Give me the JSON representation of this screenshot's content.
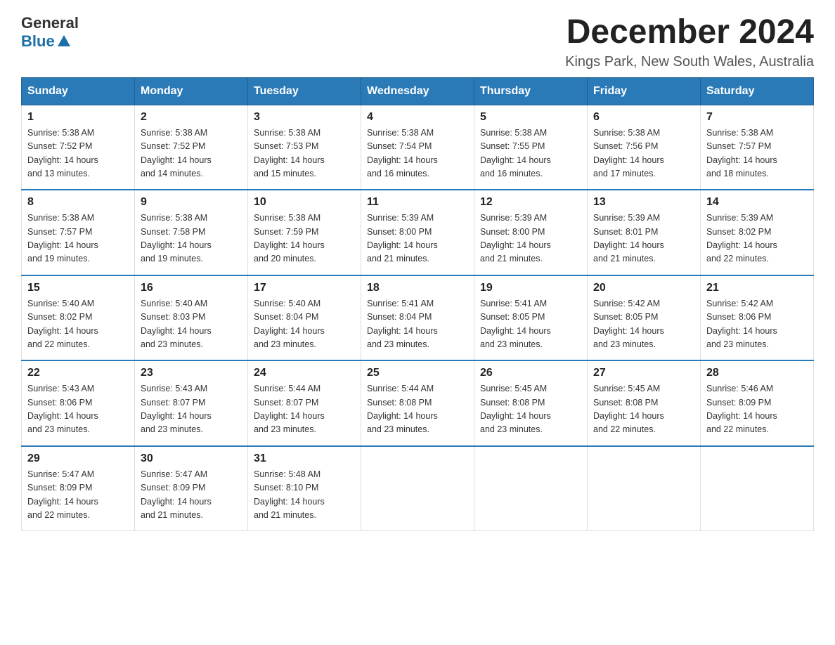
{
  "header": {
    "logo_general": "General",
    "logo_blue": "Blue",
    "month_year": "December 2024",
    "location": "Kings Park, New South Wales, Australia"
  },
  "columns": [
    "Sunday",
    "Monday",
    "Tuesday",
    "Wednesday",
    "Thursday",
    "Friday",
    "Saturday"
  ],
  "weeks": [
    [
      {
        "day": "1",
        "sunrise": "5:38 AM",
        "sunset": "7:52 PM",
        "daylight": "14 hours and 13 minutes."
      },
      {
        "day": "2",
        "sunrise": "5:38 AM",
        "sunset": "7:52 PM",
        "daylight": "14 hours and 14 minutes."
      },
      {
        "day": "3",
        "sunrise": "5:38 AM",
        "sunset": "7:53 PM",
        "daylight": "14 hours and 15 minutes."
      },
      {
        "day": "4",
        "sunrise": "5:38 AM",
        "sunset": "7:54 PM",
        "daylight": "14 hours and 16 minutes."
      },
      {
        "day": "5",
        "sunrise": "5:38 AM",
        "sunset": "7:55 PM",
        "daylight": "14 hours and 16 minutes."
      },
      {
        "day": "6",
        "sunrise": "5:38 AM",
        "sunset": "7:56 PM",
        "daylight": "14 hours and 17 minutes."
      },
      {
        "day": "7",
        "sunrise": "5:38 AM",
        "sunset": "7:57 PM",
        "daylight": "14 hours and 18 minutes."
      }
    ],
    [
      {
        "day": "8",
        "sunrise": "5:38 AM",
        "sunset": "7:57 PM",
        "daylight": "14 hours and 19 minutes."
      },
      {
        "day": "9",
        "sunrise": "5:38 AM",
        "sunset": "7:58 PM",
        "daylight": "14 hours and 19 minutes."
      },
      {
        "day": "10",
        "sunrise": "5:38 AM",
        "sunset": "7:59 PM",
        "daylight": "14 hours and 20 minutes."
      },
      {
        "day": "11",
        "sunrise": "5:39 AM",
        "sunset": "8:00 PM",
        "daylight": "14 hours and 21 minutes."
      },
      {
        "day": "12",
        "sunrise": "5:39 AM",
        "sunset": "8:00 PM",
        "daylight": "14 hours and 21 minutes."
      },
      {
        "day": "13",
        "sunrise": "5:39 AM",
        "sunset": "8:01 PM",
        "daylight": "14 hours and 21 minutes."
      },
      {
        "day": "14",
        "sunrise": "5:39 AM",
        "sunset": "8:02 PM",
        "daylight": "14 hours and 22 minutes."
      }
    ],
    [
      {
        "day": "15",
        "sunrise": "5:40 AM",
        "sunset": "8:02 PM",
        "daylight": "14 hours and 22 minutes."
      },
      {
        "day": "16",
        "sunrise": "5:40 AM",
        "sunset": "8:03 PM",
        "daylight": "14 hours and 23 minutes."
      },
      {
        "day": "17",
        "sunrise": "5:40 AM",
        "sunset": "8:04 PM",
        "daylight": "14 hours and 23 minutes."
      },
      {
        "day": "18",
        "sunrise": "5:41 AM",
        "sunset": "8:04 PM",
        "daylight": "14 hours and 23 minutes."
      },
      {
        "day": "19",
        "sunrise": "5:41 AM",
        "sunset": "8:05 PM",
        "daylight": "14 hours and 23 minutes."
      },
      {
        "day": "20",
        "sunrise": "5:42 AM",
        "sunset": "8:05 PM",
        "daylight": "14 hours and 23 minutes."
      },
      {
        "day": "21",
        "sunrise": "5:42 AM",
        "sunset": "8:06 PM",
        "daylight": "14 hours and 23 minutes."
      }
    ],
    [
      {
        "day": "22",
        "sunrise": "5:43 AM",
        "sunset": "8:06 PM",
        "daylight": "14 hours and 23 minutes."
      },
      {
        "day": "23",
        "sunrise": "5:43 AM",
        "sunset": "8:07 PM",
        "daylight": "14 hours and 23 minutes."
      },
      {
        "day": "24",
        "sunrise": "5:44 AM",
        "sunset": "8:07 PM",
        "daylight": "14 hours and 23 minutes."
      },
      {
        "day": "25",
        "sunrise": "5:44 AM",
        "sunset": "8:08 PM",
        "daylight": "14 hours and 23 minutes."
      },
      {
        "day": "26",
        "sunrise": "5:45 AM",
        "sunset": "8:08 PM",
        "daylight": "14 hours and 23 minutes."
      },
      {
        "day": "27",
        "sunrise": "5:45 AM",
        "sunset": "8:08 PM",
        "daylight": "14 hours and 22 minutes."
      },
      {
        "day": "28",
        "sunrise": "5:46 AM",
        "sunset": "8:09 PM",
        "daylight": "14 hours and 22 minutes."
      }
    ],
    [
      {
        "day": "29",
        "sunrise": "5:47 AM",
        "sunset": "8:09 PM",
        "daylight": "14 hours and 22 minutes."
      },
      {
        "day": "30",
        "sunrise": "5:47 AM",
        "sunset": "8:09 PM",
        "daylight": "14 hours and 21 minutes."
      },
      {
        "day": "31",
        "sunrise": "5:48 AM",
        "sunset": "8:10 PM",
        "daylight": "14 hours and 21 minutes."
      },
      null,
      null,
      null,
      null
    ]
  ],
  "labels": {
    "sunrise": "Sunrise:",
    "sunset": "Sunset:",
    "daylight": "Daylight:"
  }
}
